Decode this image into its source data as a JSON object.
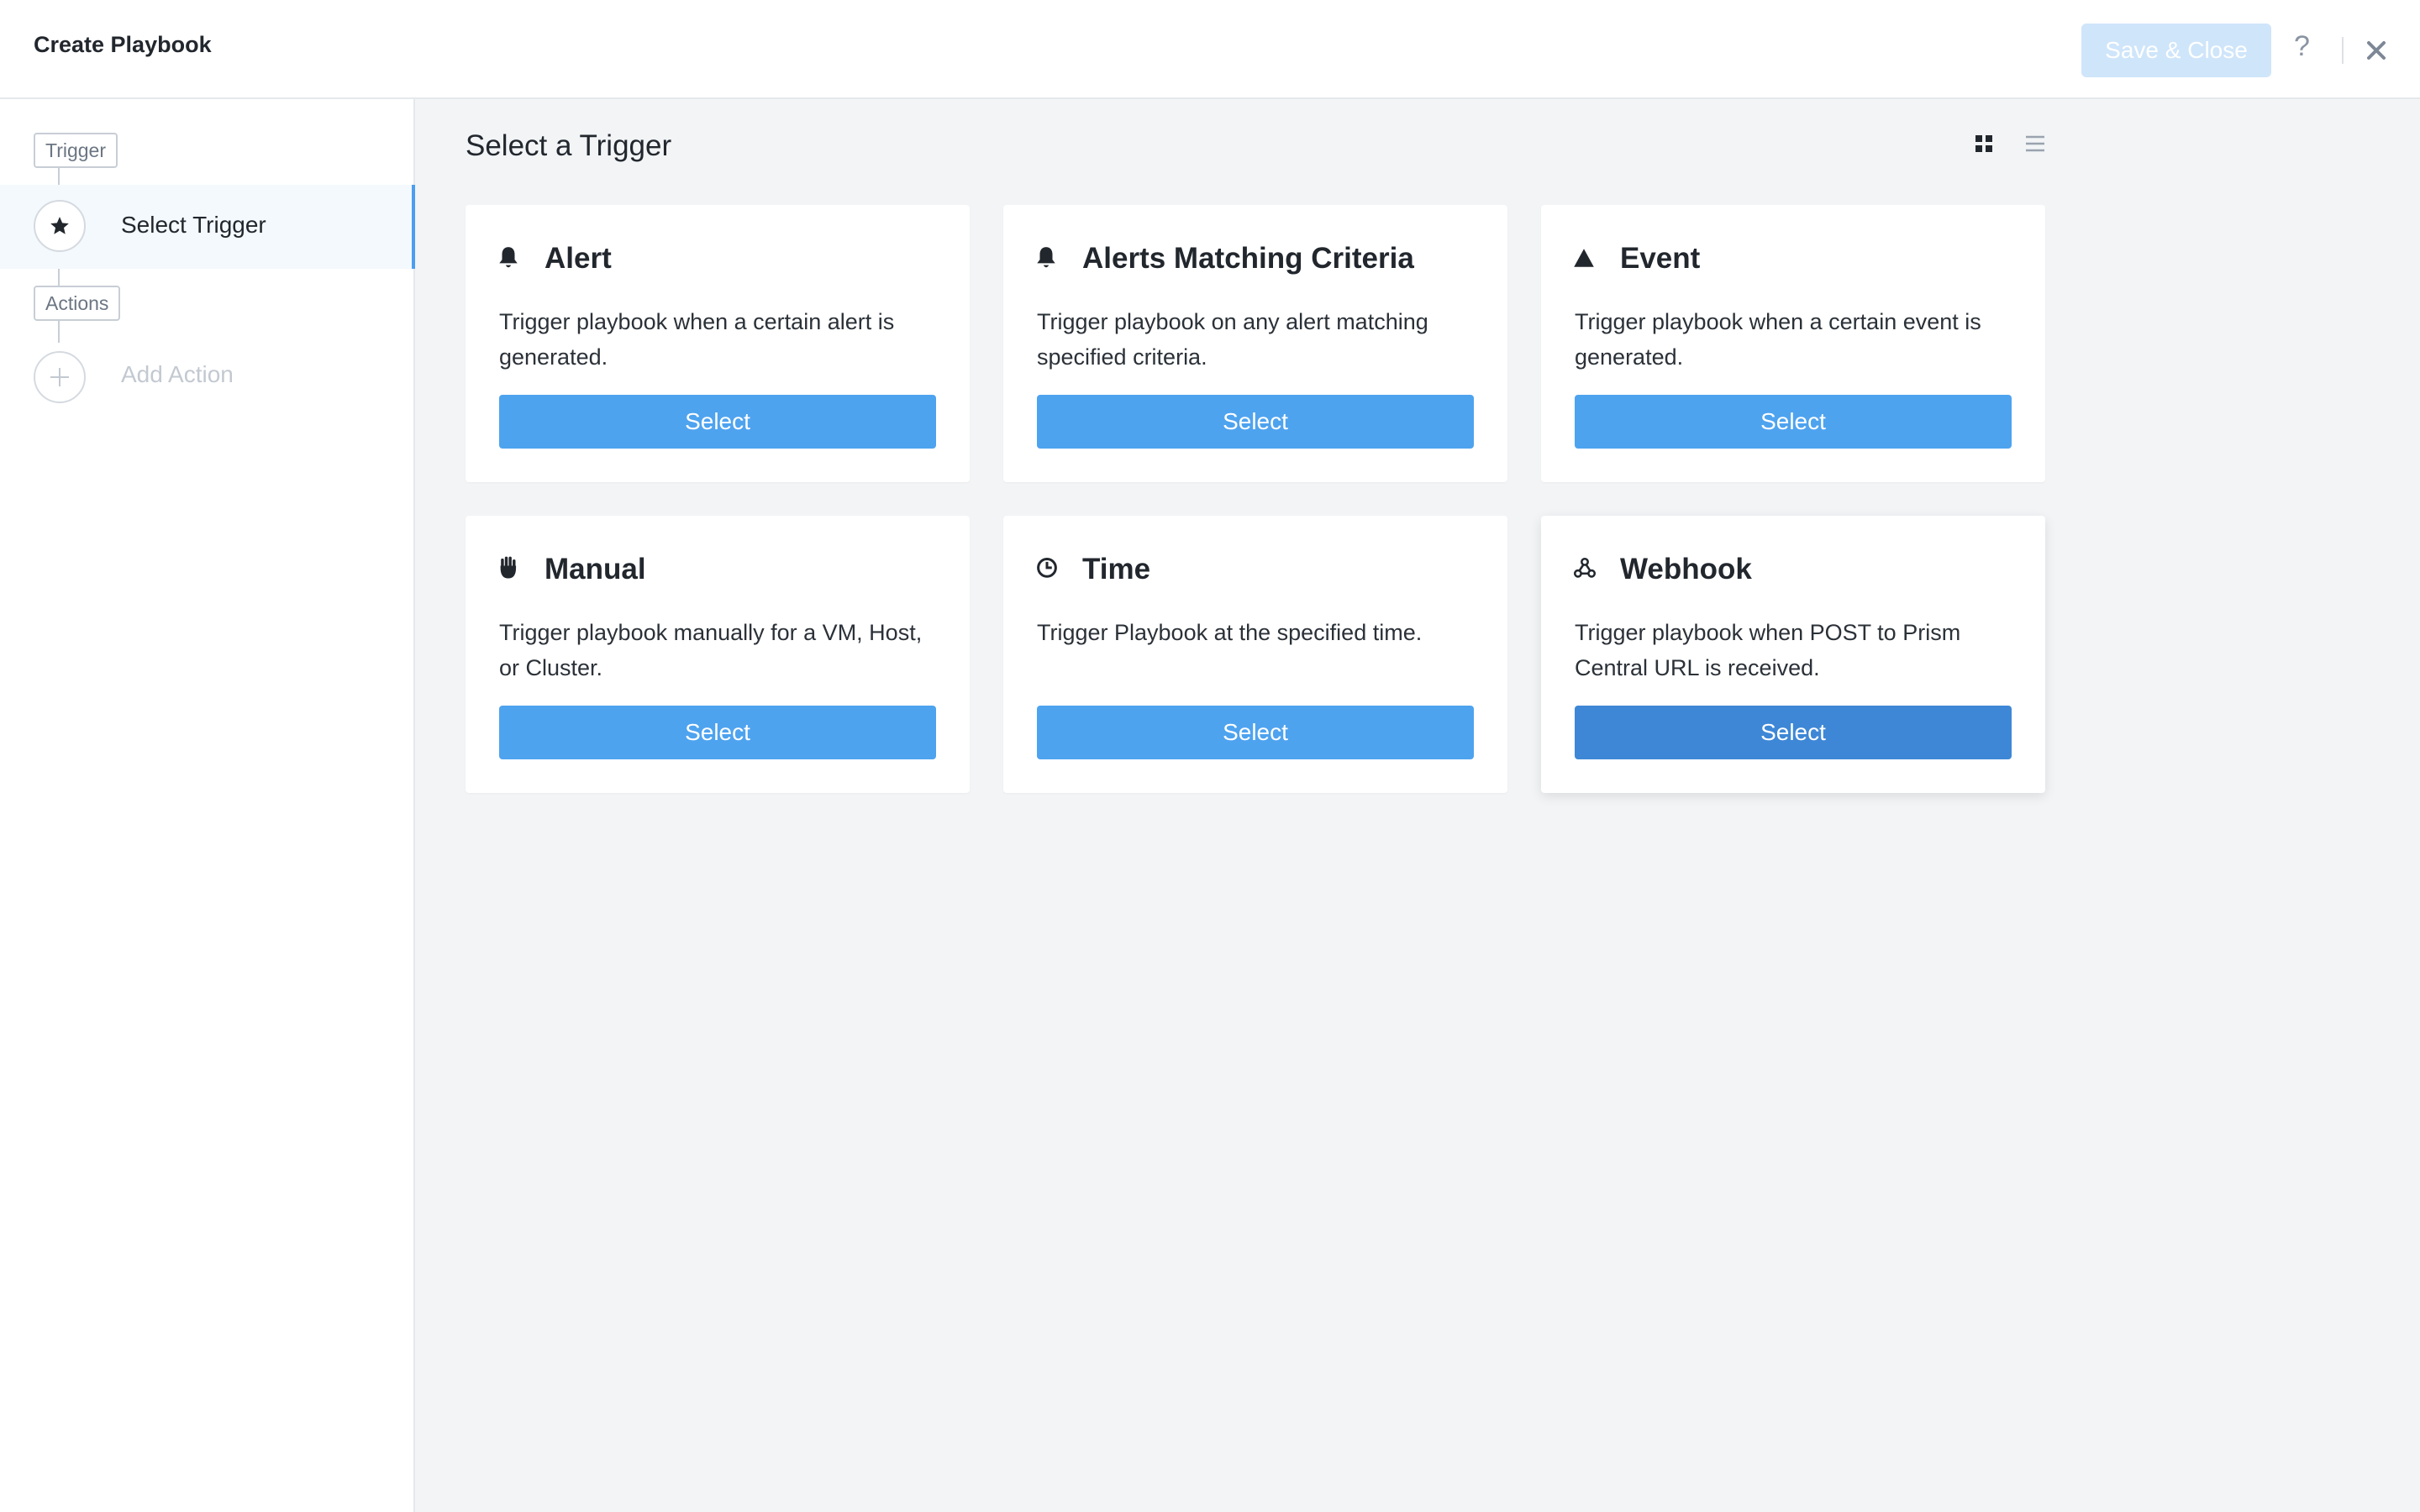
{
  "header": {
    "title": "Create Playbook",
    "save_label": "Save & Close",
    "help_label": "?"
  },
  "sidebar": {
    "trigger_tag": "Trigger",
    "select_trigger_label": "Select Trigger",
    "actions_tag": "Actions",
    "add_action_label": "Add Action"
  },
  "main": {
    "title": "Select a Trigger",
    "cards": [
      {
        "icon": "bell-icon",
        "title": "Alert",
        "description": "Trigger playbook when a certain alert is generated.",
        "button": "Select"
      },
      {
        "icon": "bell-icon",
        "title": "Alerts Matching Criteria",
        "description": "Trigger playbook on any alert matching specified criteria.",
        "button": "Select"
      },
      {
        "icon": "triangle-icon",
        "title": "Event",
        "description": "Trigger playbook when a certain event is generated.",
        "button": "Select"
      },
      {
        "icon": "hand-icon",
        "title": "Manual",
        "description": "Trigger playbook manually for a VM, Host, or Cluster.",
        "button": "Select"
      },
      {
        "icon": "clock-icon",
        "title": "Time",
        "description": "Trigger Playbook at the specified time.",
        "button": "Select"
      },
      {
        "icon": "webhook-icon",
        "title": "Webhook",
        "description": "Trigger playbook when POST to Prism Central URL is received.",
        "button": "Select"
      }
    ]
  },
  "colors": {
    "accent": "#4ea3ef",
    "accent_hover": "#3e87d6",
    "save_disabled": "#cfe5fa",
    "background": "#f2f4f6"
  }
}
